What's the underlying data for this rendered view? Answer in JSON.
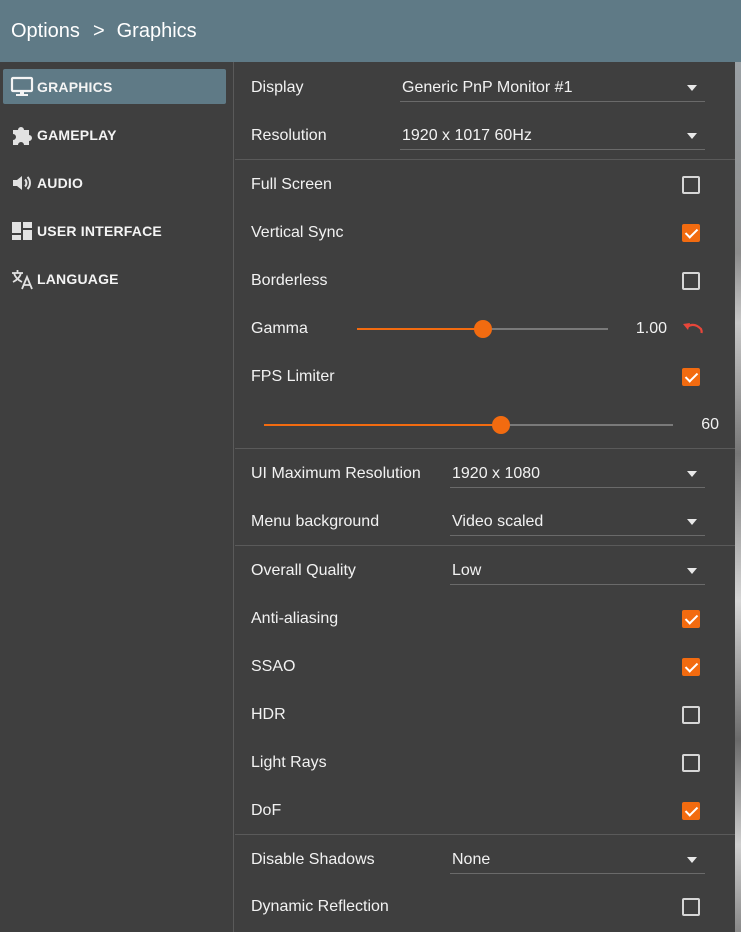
{
  "breadcrumb": {
    "root": "Options",
    "separator": ">",
    "current": "Graphics"
  },
  "sidebar": {
    "items": [
      {
        "label": "GRAPHICS",
        "icon": "monitor-icon",
        "active": true
      },
      {
        "label": "GAMEPLAY",
        "icon": "puzzle-icon",
        "active": false
      },
      {
        "label": "AUDIO",
        "icon": "speaker-icon",
        "active": false
      },
      {
        "label": "USER INTERFACE",
        "icon": "layout-icon",
        "active": false
      },
      {
        "label": "LANGUAGE",
        "icon": "translate-icon",
        "active": false
      }
    ]
  },
  "settings": {
    "display": {
      "label": "Display",
      "value": "Generic PnP Monitor #1"
    },
    "resolution": {
      "label": "Resolution",
      "value": "1920 x 1017 60Hz"
    },
    "full_screen": {
      "label": "Full Screen",
      "checked": false
    },
    "vertical_sync": {
      "label": "Vertical Sync",
      "checked": true
    },
    "borderless": {
      "label": "Borderless",
      "checked": false
    },
    "gamma": {
      "label": "Gamma",
      "value": "1.00",
      "level": 0.5
    },
    "fps_limiter": {
      "label": "FPS Limiter",
      "checked": true,
      "value": "60",
      "level": 0.58
    },
    "ui_max_resolution": {
      "label": "UI Maximum Resolution",
      "value": "1920 x 1080"
    },
    "menu_background": {
      "label": "Menu background",
      "value": "Video scaled"
    },
    "overall_quality": {
      "label": "Overall Quality",
      "value": "Low"
    },
    "anti_aliasing": {
      "label": "Anti-aliasing",
      "checked": true
    },
    "ssao": {
      "label": "SSAO",
      "checked": true
    },
    "hdr": {
      "label": "HDR",
      "checked": false
    },
    "light_rays": {
      "label": "Light Rays",
      "checked": false
    },
    "dof": {
      "label": "DoF",
      "checked": true
    },
    "disable_shadows": {
      "label": "Disable Shadows",
      "value": "None"
    },
    "dynamic_reflection": {
      "label": "Dynamic Reflection",
      "checked": false
    }
  },
  "colors": {
    "accent": "#f26b10",
    "header": "#5f7a86",
    "background": "#3f3f3f",
    "reset": "#e8463a"
  }
}
